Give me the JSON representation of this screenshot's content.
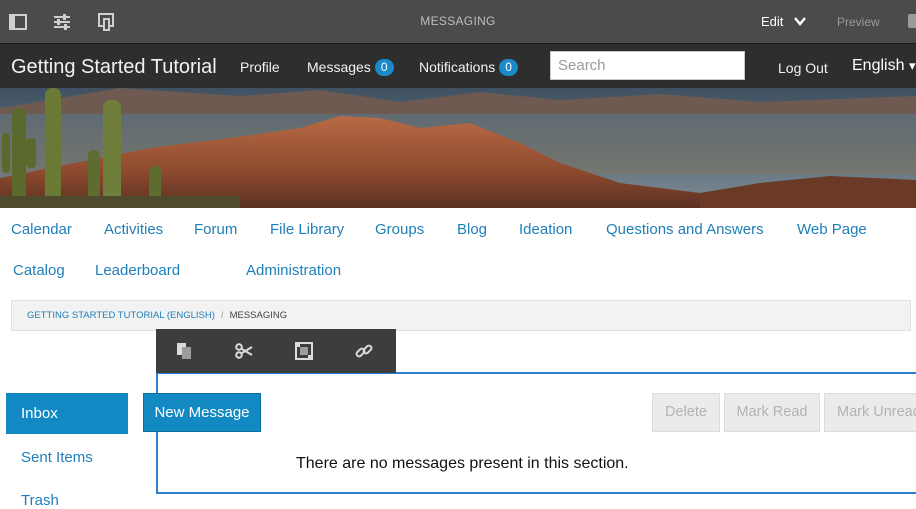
{
  "editor_bar": {
    "title": "MESSAGING",
    "edit_label": "Edit",
    "preview_label": "Preview",
    "icons": [
      "toggle-side-panel-icon",
      "page-properties-icon",
      "emulator-icon",
      "chevron-down-icon",
      "annotate-icon"
    ]
  },
  "header": {
    "site_title": "Getting Started Tutorial",
    "profile_label": "Profile",
    "messages_label": "Messages",
    "messages_count": "0",
    "notifications_label": "Notifications",
    "notifications_count": "0",
    "search_placeholder": "Search",
    "logout_label": "Log Out",
    "language_label": "English",
    "language_caret": "▾"
  },
  "main_nav": {
    "row1": [
      "Calendar",
      "Activities",
      "Forum",
      "File Library",
      "Groups",
      "Blog",
      "Ideation",
      "Questions and Answers",
      "Web Page"
    ],
    "row2": [
      "Catalog",
      "Leaderboard",
      "Administration"
    ]
  },
  "breadcrumb": {
    "parent": "GETTING STARTED TUTORIAL (ENGLISH)",
    "separator": "/",
    "current": "MESSAGING"
  },
  "component_toolbar": {
    "icons": [
      "copy-icon",
      "cut-icon",
      "insert-component-icon",
      "link-icon"
    ]
  },
  "sidebar": {
    "items": [
      {
        "label": "Inbox",
        "active": true
      },
      {
        "label": "Sent Items",
        "active": false
      },
      {
        "label": "Trash",
        "active": false
      }
    ]
  },
  "actions": {
    "new_message": "New Message",
    "delete": "Delete",
    "mark_read": "Mark Read",
    "mark_unread": "Mark Unread"
  },
  "messages": {
    "empty_text": "There are no messages present in this section."
  },
  "colors": {
    "accent": "#1389c3",
    "link": "#1e7fb8",
    "editor_bar": "#4b4b4b",
    "header": "#2e2e2e",
    "frame": "#2d7fcf"
  }
}
